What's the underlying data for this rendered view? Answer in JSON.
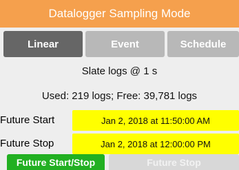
{
  "title": "Datalogger Sampling Mode",
  "modes": {
    "linear": "Linear",
    "event": "Event",
    "schedule": "Schedule"
  },
  "status": {
    "slate_logs": "Slate logs @ 1 s",
    "usage": "Used: 219 logs; Free: 39,781 logs"
  },
  "future_start": {
    "label": "Future Start",
    "value": "Jan 2, 2018 at 11:50:00 AM"
  },
  "future_stop": {
    "label": "Future Stop",
    "value": "Jan 2, 2018 at 12:00:00 PM"
  },
  "buttons": {
    "future_start_stop": "Future Start/Stop",
    "future_stop": "Future Stop"
  },
  "colors": {
    "title_bar": "#f5a04d",
    "active_mode": "#666666",
    "inactive_mode": "#b8b8b8",
    "time_field": "#ffff00",
    "start_stop_button": "#22b022",
    "disabled_button": "#d8d8d8"
  }
}
